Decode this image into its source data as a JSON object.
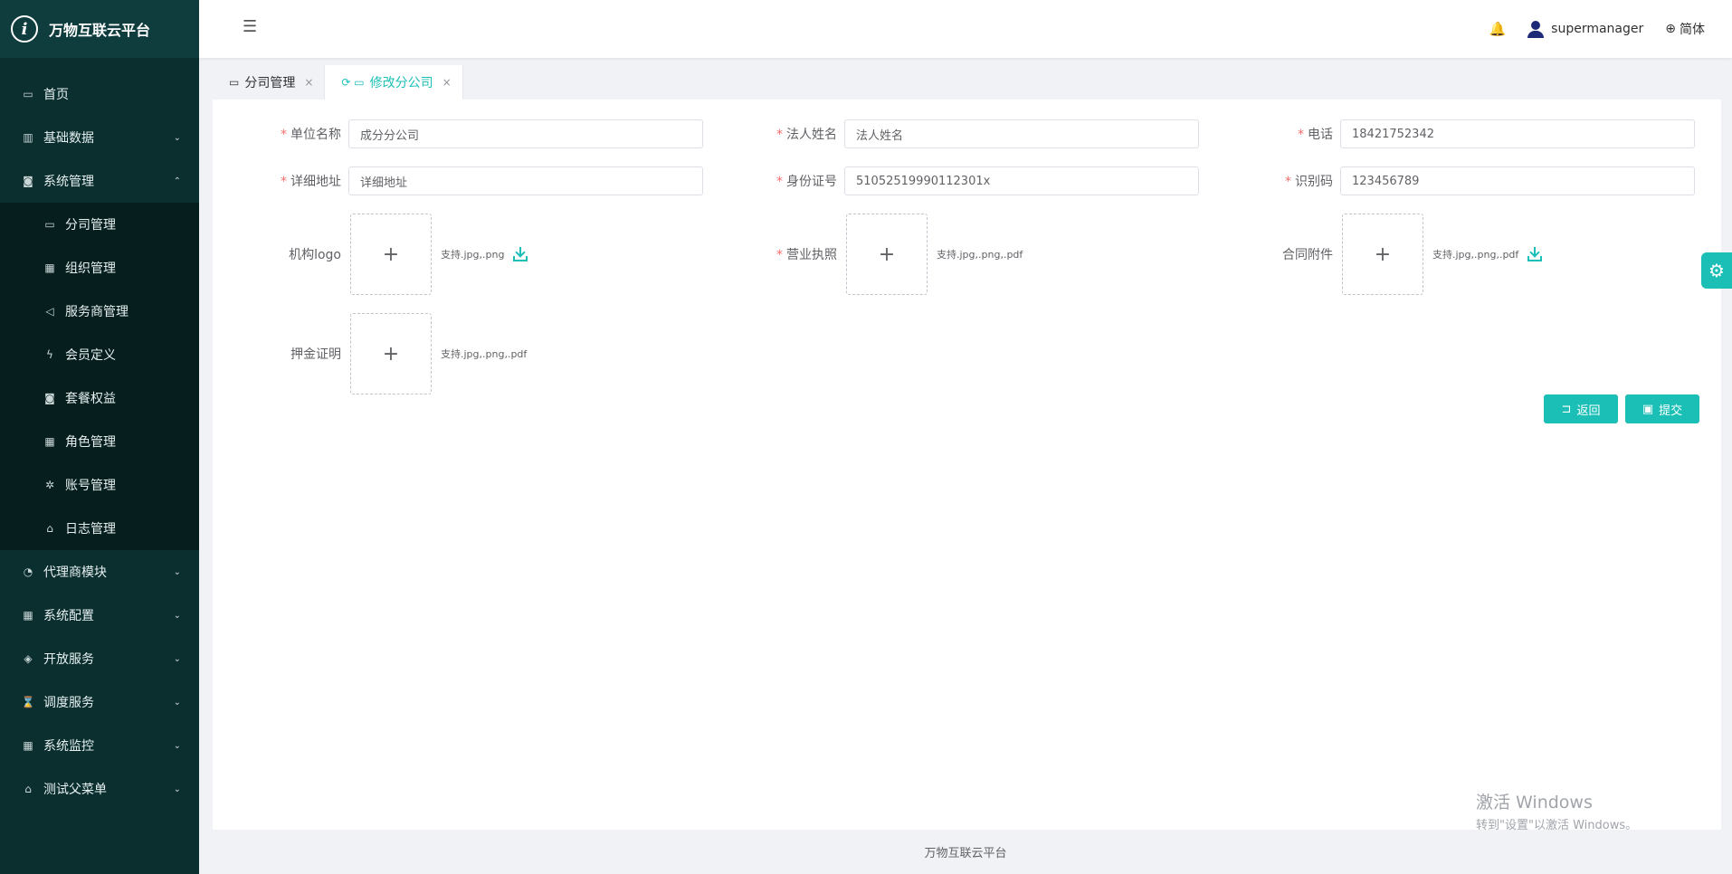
{
  "app": {
    "title": "万物互联云平台",
    "logo_letter": "i"
  },
  "sidebar": {
    "items": [
      {
        "label": "首页",
        "icon": "calendar-icon",
        "glyph": "▭"
      },
      {
        "label": "基础数据",
        "icon": "barcode-icon",
        "glyph": "▥",
        "chevron": "⌄"
      },
      {
        "label": "系统管理",
        "icon": "camera-icon",
        "glyph": "◙",
        "chevron": "⌃"
      },
      {
        "label": "代理商模块",
        "icon": "bell-icon",
        "glyph": "◔",
        "chevron": "⌄"
      },
      {
        "label": "系统配置",
        "icon": "grid-icon",
        "glyph": "▦",
        "chevron": "⌄"
      },
      {
        "label": "开放服务",
        "icon": "tag-icon",
        "glyph": "◈",
        "chevron": "⌄"
      },
      {
        "label": "调度服务",
        "icon": "hourglass-icon",
        "glyph": "⌛",
        "chevron": "⌄"
      },
      {
        "label": "系统监控",
        "icon": "grid-icon",
        "glyph": "▦",
        "chevron": "⌄"
      },
      {
        "label": "测试父菜单",
        "icon": "bank-icon",
        "glyph": "⌂",
        "chevron": "⌄"
      }
    ],
    "submenu": [
      {
        "label": "分司管理",
        "icon": "calendar-icon",
        "glyph": "▭"
      },
      {
        "label": "组织管理",
        "icon": "grid-icon",
        "glyph": "▦"
      },
      {
        "label": "服务商管理",
        "icon": "speaker-icon",
        "glyph": "◁"
      },
      {
        "label": "会员定义",
        "icon": "lightning-icon",
        "glyph": "ϟ"
      },
      {
        "label": "套餐权益",
        "icon": "camera-icon",
        "glyph": "◙"
      },
      {
        "label": "角色管理",
        "icon": "grid-icon",
        "glyph": "▦"
      },
      {
        "label": "账号管理",
        "icon": "bug-icon",
        "glyph": "✲"
      },
      {
        "label": "日志管理",
        "icon": "home-icon",
        "glyph": "⌂"
      }
    ]
  },
  "header": {
    "fold_glyph": "☰",
    "bell_glyph": "🔔",
    "user": "supermanager",
    "lang_glyph": "⊕",
    "lang": "简体"
  },
  "tabs": [
    {
      "label": "分司管理",
      "icon_glyph": "▭",
      "close": "×",
      "active": false
    },
    {
      "label": "修改分公司",
      "icon_glyph": "⟳ ▭",
      "close": "×",
      "active": true
    }
  ],
  "form": {
    "required_mark": "*",
    "company_name": {
      "label": "单位名称",
      "value": "成分分公司"
    },
    "legal_name": {
      "label": "法人姓名",
      "value": "法人姓名"
    },
    "phone": {
      "label": "电话",
      "value": "18421752342"
    },
    "address": {
      "label": "详细地址",
      "value": "详细地址"
    },
    "id_number": {
      "label": "身份证号",
      "value": "51052519990112301x"
    },
    "code": {
      "label": "识别码",
      "value": "123456789"
    },
    "logo": {
      "label": "机构logo",
      "tip": "支持.jpg,.png"
    },
    "license": {
      "label": "营业执照",
      "tip": "支持.jpg,.png,.pdf"
    },
    "contract": {
      "label": "合同附件",
      "tip": "支持.jpg,.png,.pdf"
    },
    "deposit": {
      "label": "押金证明",
      "tip": "支持.jpg,.png,.pdf"
    },
    "plus": "+"
  },
  "buttons": {
    "back": {
      "label": "返回",
      "glyph": "⊐"
    },
    "submit": {
      "label": "提交",
      "glyph": "▣"
    }
  },
  "footer": {
    "text": "万物互联云平台"
  },
  "settings_glyph": "⚙",
  "watermark": {
    "line1": "激活 Windows",
    "line2": "转到\"设置\"以激活 Windows。"
  },
  "colors": {
    "accent": "#1bbfb6",
    "sidebar_bg": "#0b2e2f",
    "required": "#f56c6c"
  }
}
